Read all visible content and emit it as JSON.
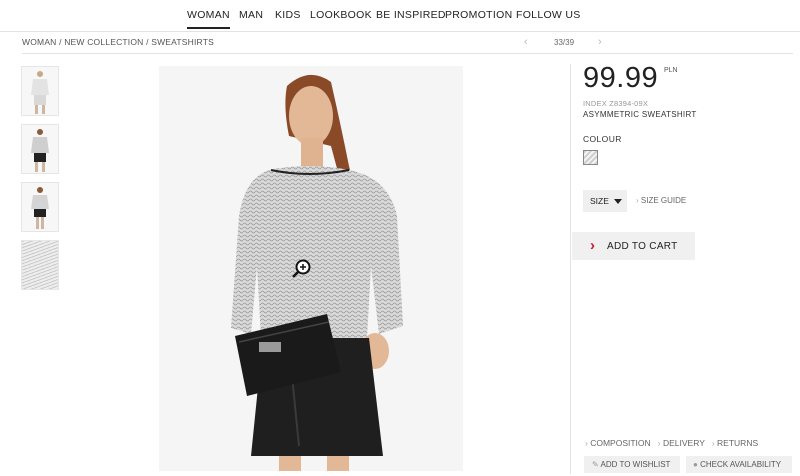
{
  "nav": {
    "items": [
      {
        "label": "WOMAN",
        "active": true
      },
      {
        "label": "MAN"
      },
      {
        "label": "KIDS"
      },
      {
        "label": "LOOKBOOK"
      },
      {
        "label": "BE INSPIRED"
      },
      {
        "label": "PROMOTION"
      },
      {
        "label": "FOLLOW US"
      }
    ]
  },
  "breadcrumb": "WOMAN / NEW COLLECTION / SWEATSHIRTS",
  "pager": {
    "count": "33/39",
    "prev_icon": "chevron-left-icon",
    "next_icon": "chevron-right-icon"
  },
  "product": {
    "price": "99.99",
    "currency": "PLN",
    "index": "INDEX Z8394-09X",
    "name": "ASYMMETRIC SWEATSHIRT",
    "colour_label": "COLOUR",
    "size_label": "SIZE",
    "size_guide": "SIZE GUIDE",
    "add_to_cart": "ADD TO CART",
    "accent_color": "#c0202a"
  },
  "links": {
    "composition": "COMPOSITION",
    "delivery": "DELIVERY",
    "returns": "RETURNS"
  },
  "actions": {
    "wishlist": "ADD TO WISHLIST",
    "availability": "CHECK AVAILABILITY"
  }
}
